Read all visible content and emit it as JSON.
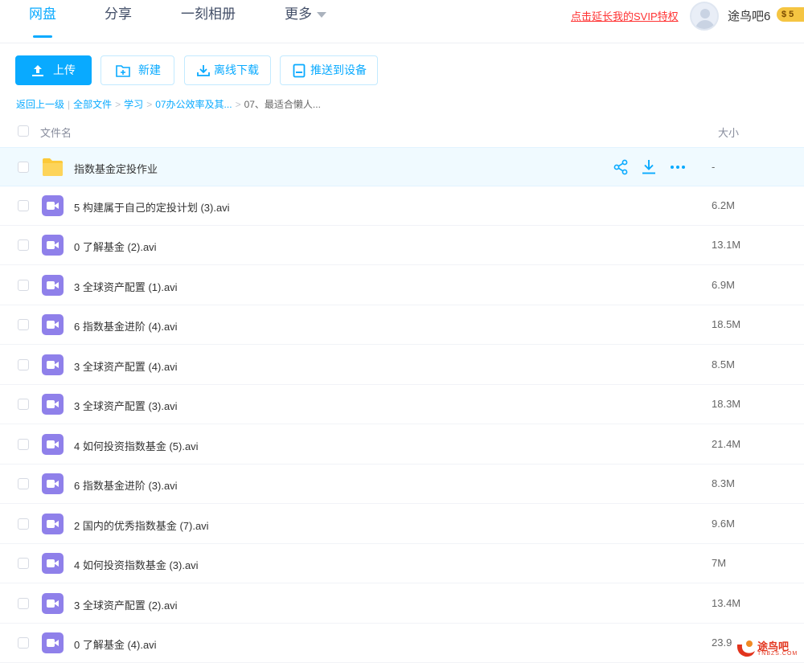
{
  "nav": {
    "tabs": [
      {
        "label": "网盘"
      },
      {
        "label": "分享"
      },
      {
        "label": "一刻相册"
      },
      {
        "label": "更多"
      }
    ],
    "svip_link": "点击延长我的SVIP特权",
    "username": "途鸟吧6",
    "vip_badge": "$ 5"
  },
  "toolbar": {
    "upload": "上传",
    "new": "新建",
    "offline_download": "离线下载",
    "push_device": "推送到设备"
  },
  "breadcrumb": {
    "back": "返回上一级",
    "all_files": "全部文件",
    "level1": "学习",
    "level2": "07办公效率及其...",
    "current": "07、最适合懒人..."
  },
  "table": {
    "col_name": "文件名",
    "col_size": "大小"
  },
  "files": [
    {
      "name": "指数基金定投作业",
      "size": "-",
      "type": "folder"
    },
    {
      "name": "5 构建属于自己的定投计划 (3).avi",
      "size": "6.2M",
      "type": "video"
    },
    {
      "name": "0 了解基金 (2).avi",
      "size": "13.1M",
      "type": "video"
    },
    {
      "name": "3 全球资产配置 (1).avi",
      "size": "6.9M",
      "type": "video"
    },
    {
      "name": "6 指数基金进阶 (4).avi",
      "size": "18.5M",
      "type": "video"
    },
    {
      "name": "3 全球资产配置 (4).avi",
      "size": "8.5M",
      "type": "video"
    },
    {
      "name": "3 全球资产配置 (3).avi",
      "size": "18.3M",
      "type": "video"
    },
    {
      "name": "4 如何投资指数基金 (5).avi",
      "size": "21.4M",
      "type": "video"
    },
    {
      "name": "6 指数基金进阶 (3).avi",
      "size": "8.3M",
      "type": "video"
    },
    {
      "name": "2 国内的优秀指数基金 (7).avi",
      "size": "9.6M",
      "type": "video"
    },
    {
      "name": "4 如何投资指数基金 (3).avi",
      "size": "7M",
      "type": "video"
    },
    {
      "name": "3 全球资产配置 (2).avi",
      "size": "13.4M",
      "type": "video"
    },
    {
      "name": "0 了解基金 (4).avi",
      "size": "23.9",
      "type": "video"
    }
  ],
  "watermark": {
    "text": "途鸟吧",
    "sub": "TNBZS.COM"
  },
  "colors": {
    "accent": "#09aaff",
    "folder": "#fcc93a",
    "video": "#8f80ea",
    "link_red": "#ff3333"
  }
}
